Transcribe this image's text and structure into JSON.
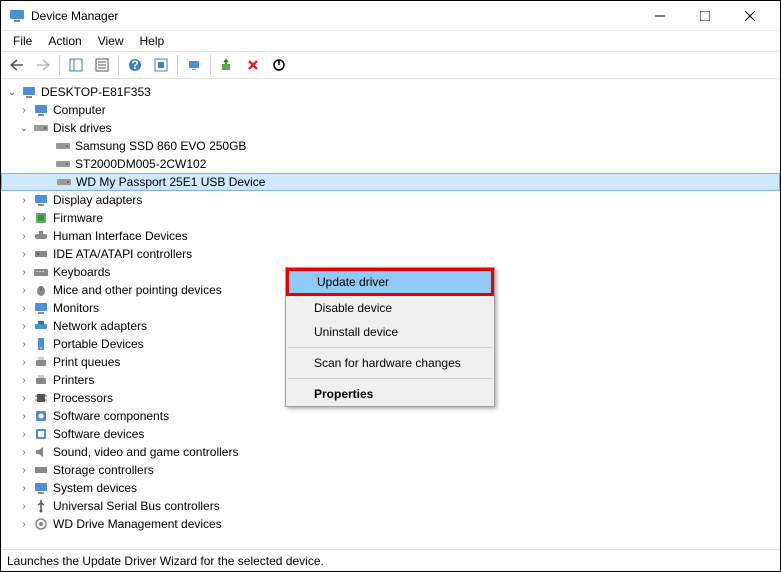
{
  "window": {
    "title": "Device Manager"
  },
  "menubar": [
    "File",
    "Action",
    "View",
    "Help"
  ],
  "tree": {
    "root": "DESKTOP-E81F353",
    "computer": "Computer",
    "diskdrives": {
      "label": "Disk drives",
      "children": [
        "Samsung SSD 860 EVO 250GB",
        "ST2000DM005-2CW102",
        "WD My Passport 25E1 USB Device"
      ]
    },
    "categories": [
      "Display adapters",
      "Firmware",
      "Human Interface Devices",
      "IDE ATA/ATAPI controllers",
      "Keyboards",
      "Mice and other pointing devices",
      "Monitors",
      "Network adapters",
      "Portable Devices",
      "Print queues",
      "Printers",
      "Processors",
      "Software components",
      "Software devices",
      "Sound, video and game controllers",
      "Storage controllers",
      "System devices",
      "Universal Serial Bus controllers",
      "WD Drive Management devices"
    ]
  },
  "context_menu": {
    "update": "Update driver",
    "disable": "Disable device",
    "uninstall": "Uninstall device",
    "scan": "Scan for hardware changes",
    "properties": "Properties"
  },
  "statusbar": "Launches the Update Driver Wizard for the selected device."
}
